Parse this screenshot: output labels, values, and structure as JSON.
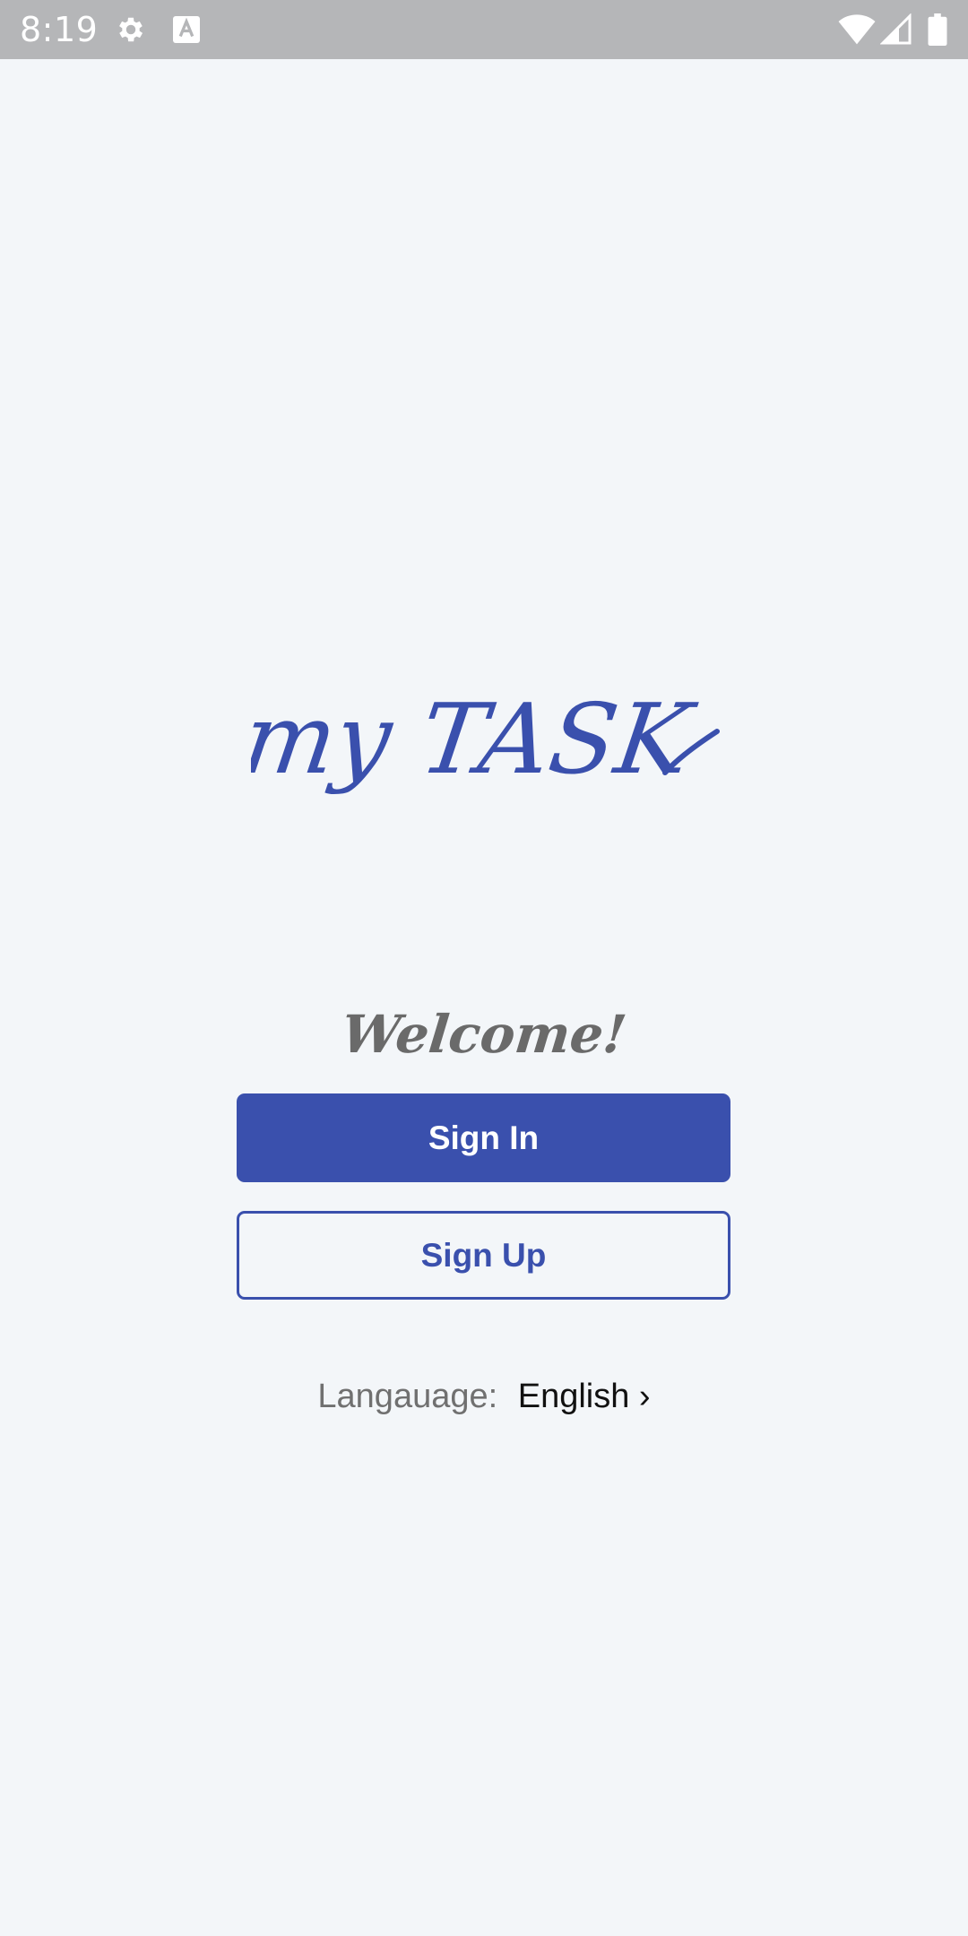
{
  "status_bar": {
    "time": "8:19",
    "icons": [
      "gear-icon",
      "a-keyboard-icon",
      "wifi-icon",
      "signal-icon",
      "battery-icon"
    ]
  },
  "logo": {
    "text": "my TASK",
    "color": "#3a50ad"
  },
  "welcome_text": "Welcome!",
  "buttons": {
    "sign_in": "Sign In",
    "sign_up": "Sign Up"
  },
  "language": {
    "label": "Langauage:",
    "value": "English ›"
  },
  "colors": {
    "primary": "#3a50ad",
    "background": "#f3f6f9",
    "status_bar": "#b5b6b8"
  }
}
